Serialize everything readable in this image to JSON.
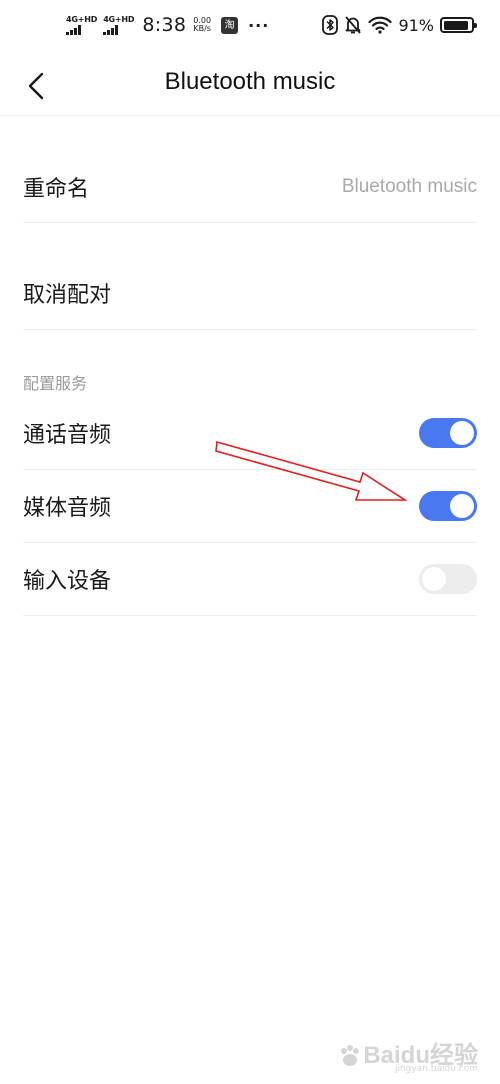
{
  "status_bar": {
    "signal1_label": "4G+HD",
    "signal2_label": "4G+HD",
    "time": "8:38",
    "speed_value": "0.00",
    "speed_unit": "KB/s",
    "app_badge": "淘",
    "more": "···",
    "battery_percent": "91%",
    "battery_level": 0.91
  },
  "header": {
    "title": "Bluetooth music"
  },
  "settings": {
    "rename_label": "重命名",
    "rename_value": "Bluetooth music",
    "unpair_label": "取消配对"
  },
  "services": {
    "section_title": "配置服务",
    "items": [
      {
        "label": "通话音频",
        "enabled": true
      },
      {
        "label": "媒体音频",
        "enabled": true
      },
      {
        "label": "输入设备",
        "enabled": false
      }
    ]
  },
  "colors": {
    "accent": "#4a78f0",
    "annotation_arrow": "#e02020"
  },
  "watermark": {
    "text": "Baidu经验",
    "sub": "jingyan.baidu.com"
  }
}
